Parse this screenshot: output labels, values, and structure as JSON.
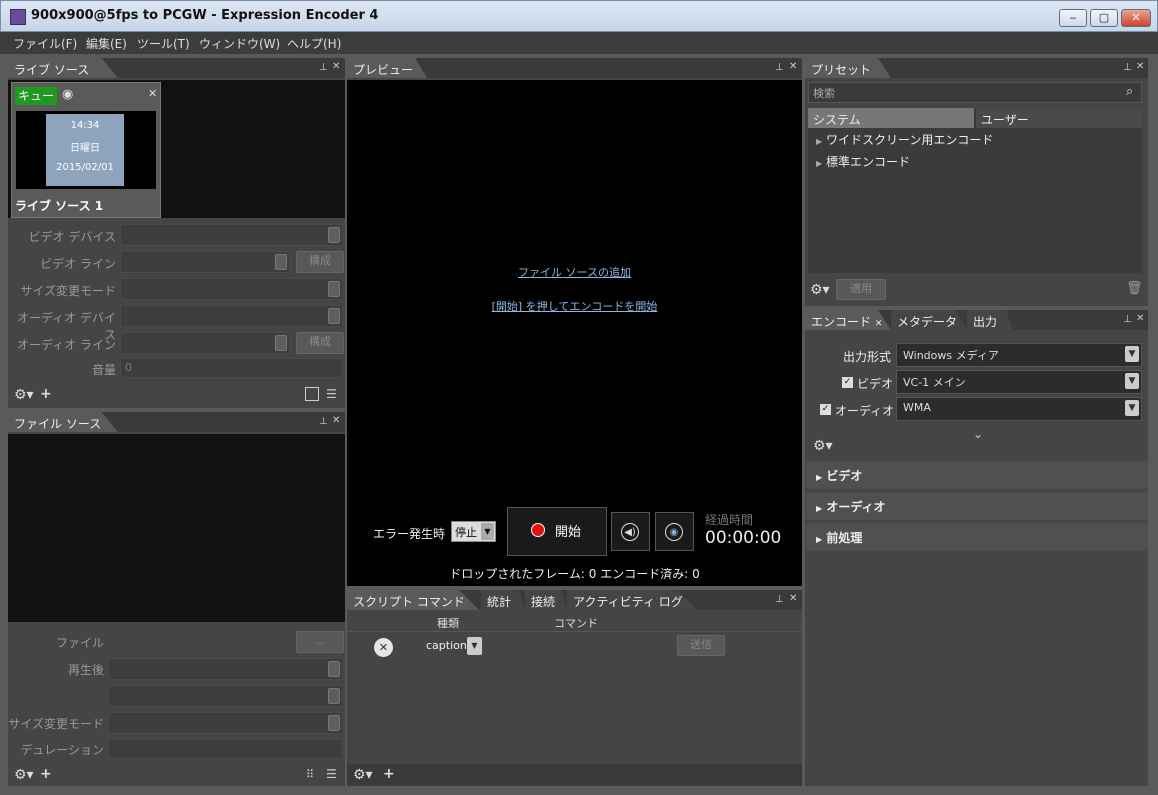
{
  "window": {
    "title": "900x900@5fps to PCGW - Expression Encoder 4",
    "min": "‒",
    "max": "▢",
    "close": "✕"
  },
  "menu": [
    "ファイル(F)",
    "編集(E)",
    "ツール(T)",
    "ウィンドウ(W)",
    "ヘルプ(H)"
  ],
  "live_source": {
    "tab": "ライブ ソース",
    "cue_label": "キュー",
    "thumb_lines": [
      "14:34",
      "日曜日",
      "2015/02/01"
    ],
    "source_name": "ライブ ソース 1",
    "fields": {
      "video_device": "ビデオ デバイス",
      "video_line": "ビデオ ライン",
      "resize_mode": "サイズ変更モード",
      "audio_device": "オーディオ デバイス",
      "audio_line": "オーディオ ライン",
      "volume": "音量",
      "volume_value": "0",
      "config": "構成"
    }
  },
  "file_source": {
    "tab": "ファイル ソース",
    "fields": {
      "file": "ファイル",
      "after_play": "再生後",
      "resize_mode": "サイズ変更モード",
      "duration": "デュレーション",
      "browse": "..."
    }
  },
  "preview": {
    "tab": "プレビュー",
    "add_source_link": "ファイル ソースの追加",
    "start_hint_link": "[開始] を押してエンコードを開始",
    "on_error_label": "エラー発生時",
    "on_error_value": "停止",
    "start_button": "開始",
    "elapsed_label": "経過時間",
    "elapsed_value": "00:00:00",
    "stats": "ドロップされたフレーム: 0 エンコード済み: 0"
  },
  "script": {
    "tabs": [
      "スクリプト コマンド",
      "統計",
      "接続",
      "アクティビティ ログ"
    ],
    "columns": [
      "種類",
      "コマンド"
    ],
    "row": {
      "type": "caption"
    },
    "send": "送信"
  },
  "presets": {
    "tab": "プリセット",
    "search_placeholder": "検索",
    "subtabs": [
      "システム",
      "ユーザー"
    ],
    "items": [
      "ワイドスクリーン用エンコード",
      "標準エンコード"
    ],
    "apply": "適用"
  },
  "encode": {
    "tabs": [
      "エンコード",
      "メタデータ",
      "出力"
    ],
    "output_format_label": "出力形式",
    "output_format": "Windows メディア",
    "video_label": "ビデオ",
    "video_value": "VC-1 メイン",
    "audio_label": "オーディオ",
    "audio_value": "WMA",
    "sections": [
      "ビデオ",
      "オーディオ",
      "前処理"
    ]
  },
  "colors": {
    "cue": "#1f9a1f",
    "record": "#e01010",
    "accent_link": "#8fb6e0"
  }
}
